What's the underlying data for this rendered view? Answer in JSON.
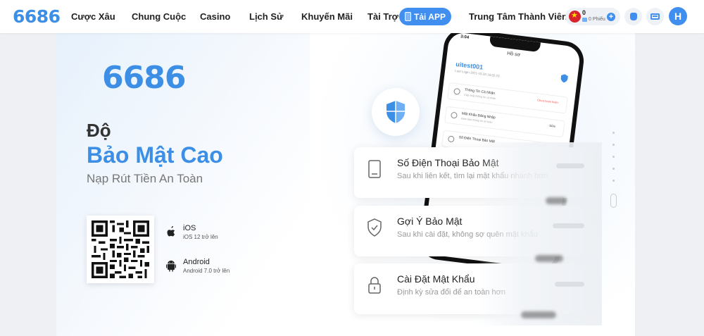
{
  "nav": {
    "logo": "6686",
    "items": [
      "Cược Xâu",
      "Chung Cuộc",
      "Casino",
      "Lịch Sử",
      "Khuyến Mãi",
      "Tài Trợ"
    ],
    "app_button": "Tải APP",
    "member_center": "Trung Tâm Thành Viên",
    "balance": "0",
    "points": "0 Phiếu",
    "avatar_letter": "H"
  },
  "hero": {
    "logo": "6686",
    "title_line1": "Độ",
    "title_line2": "Bảo Mật Cao",
    "subtitle": "Nạp Rút Tiền An Toàn",
    "downloads": [
      {
        "os": "iOS",
        "requirement": "iOS 12 trở lên"
      },
      {
        "os": "Android",
        "requirement": "Android 7.0 trở lên"
      }
    ]
  },
  "phone": {
    "time": "3:04",
    "screen_title": "Hồ sơ",
    "username": "uitest001",
    "last_login": "Last Login 2021-10-20 16:02:23",
    "rows": [
      {
        "title": "Thông Tin Cá Nhân",
        "sub": "Cập nhật thông tin cá nhân",
        "status": "Chưa hoàn thiện"
      },
      {
        "title": "Mật Khẩu Đăng Nhập",
        "sub": "Đảm bảo thông tin an toàn",
        "status": "Sửa"
      },
      {
        "title": "Số Điện Thoại Bảo Mật",
        "sub": "",
        "status": ""
      }
    ]
  },
  "features": [
    {
      "title": "Số Điện Thoại Bảo Mật",
      "desc": "Sau khi liên kết, tìm lại mật khẩu nhanh hơn"
    },
    {
      "title": "Gợi Ý Bảo Mật",
      "desc": "Sau khi cài đặt, không sợ quên mật khẩu"
    },
    {
      "title": "Cài Đặt Mật Khẩu",
      "desc": "Định kỳ sửa đổi để an toàn hơn"
    }
  ],
  "colors": {
    "brand": "#3d8fe6",
    "button": "#3f8ef0"
  }
}
